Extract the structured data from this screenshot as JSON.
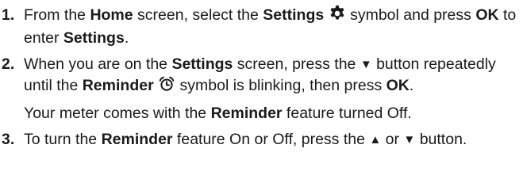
{
  "steps": [
    {
      "number": "1.",
      "t1": "From the ",
      "b1": "Home",
      "t2": " screen, select the ",
      "b2": "Settings",
      "t3": " symbol and press ",
      "b3": "OK",
      "t4": " to enter ",
      "b4": "Settings",
      "t5": ".",
      "icon": "gear-icon"
    },
    {
      "number": "2.",
      "t1": "When you are on the ",
      "b1": "Settings",
      "t2": " screen, press the ",
      "down_arrow": "▼",
      "t3": " button repeatedly until the ",
      "b2": "Reminder",
      "t4": " symbol is blinking, then press ",
      "b3": "OK",
      "t5": ".",
      "icon": "alarm-clock-icon",
      "note_t1": "Your meter comes with the ",
      "note_b1": "Reminder",
      "note_t2": " feature turned Off."
    },
    {
      "number": "3.",
      "t1": "To turn the ",
      "b1": "Reminder",
      "t2": " feature On or Off, press the ",
      "up_arrow": "▲",
      "t3": " or ",
      "down_arrow": "▼",
      "t4": " button."
    }
  ]
}
